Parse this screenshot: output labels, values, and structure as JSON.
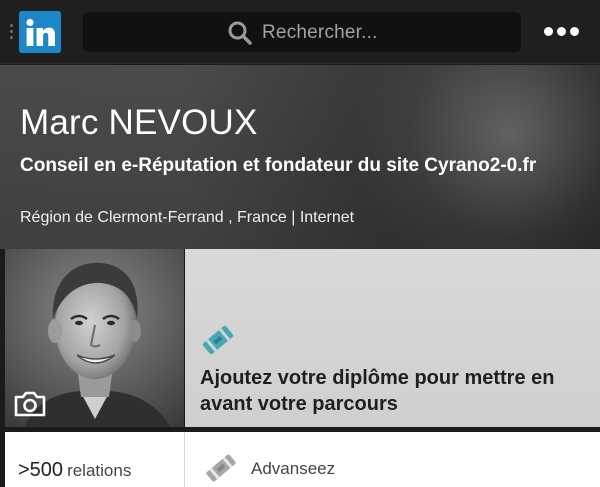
{
  "topbar": {
    "logo_text": "in",
    "search_placeholder": "Rechercher...",
    "more_icon": "more-dots-icon"
  },
  "profile": {
    "name": "Marc NEVOUX",
    "headline": "Conseil en e-Réputation et fondateur du site Cyrano2-0.fr",
    "location": "Région de Clermont-Ferrand , France | Internet"
  },
  "photo": {
    "camera_icon": "camera-icon"
  },
  "diploma_prompt": {
    "icon": "diploma-icon",
    "text": "Ajoutez votre diplôme pour mettre en avant votre parcours"
  },
  "stats": {
    "relations_count": ">500",
    "relations_label": "relations"
  },
  "suggestion": {
    "icon": "school-icon",
    "label": "Advanseez"
  },
  "colors": {
    "brand": "#1d86c6",
    "accent_diploma": "#45a9b2"
  }
}
